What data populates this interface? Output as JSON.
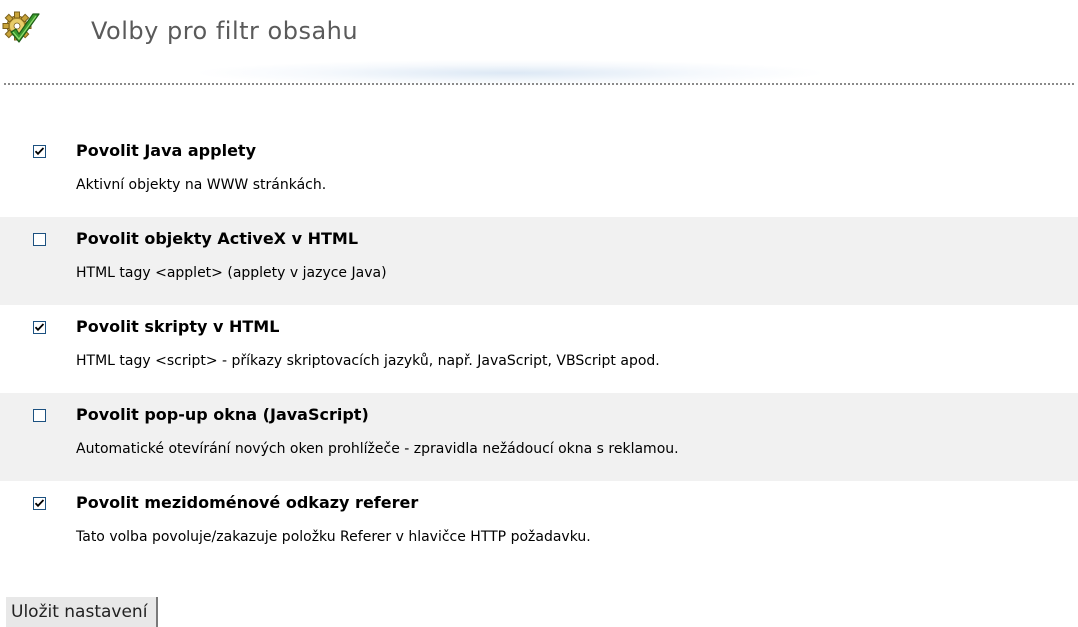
{
  "header": {
    "icon": "gear-with-check-icon",
    "title": "Volby pro filtr obsahu"
  },
  "options": [
    {
      "checked": true,
      "title": "Povolit Java applety",
      "description": "Aktivní objekty na WWW stránkách."
    },
    {
      "checked": false,
      "title": "Povolit objekty ActiveX v HTML",
      "description": "HTML tagy <applet> (applety v jazyce Java)"
    },
    {
      "checked": true,
      "title": "Povolit skripty v HTML",
      "description": "HTML tagy <script> - příkazy skriptovacích jazyků, např. JavaScript, VBScript apod."
    },
    {
      "checked": false,
      "title": "Povolit pop-up okna (JavaScript)",
      "description": "Automatické otevírání nových oken prohlížeče - zpravidla nežádoucí okna s reklamou."
    },
    {
      "checked": true,
      "title": "Povolit mezidoménové odkazy referer",
      "description": "Tato volba povoluje/zakazuje položku Referer v hlavičce HTTP požadavku."
    }
  ],
  "save_button": {
    "label": "Uložit nastavení"
  },
  "colors": {
    "title_text": "#5a5a5a",
    "row_shade": "#f1f1f1",
    "checkbox_border": "#1c5180"
  }
}
